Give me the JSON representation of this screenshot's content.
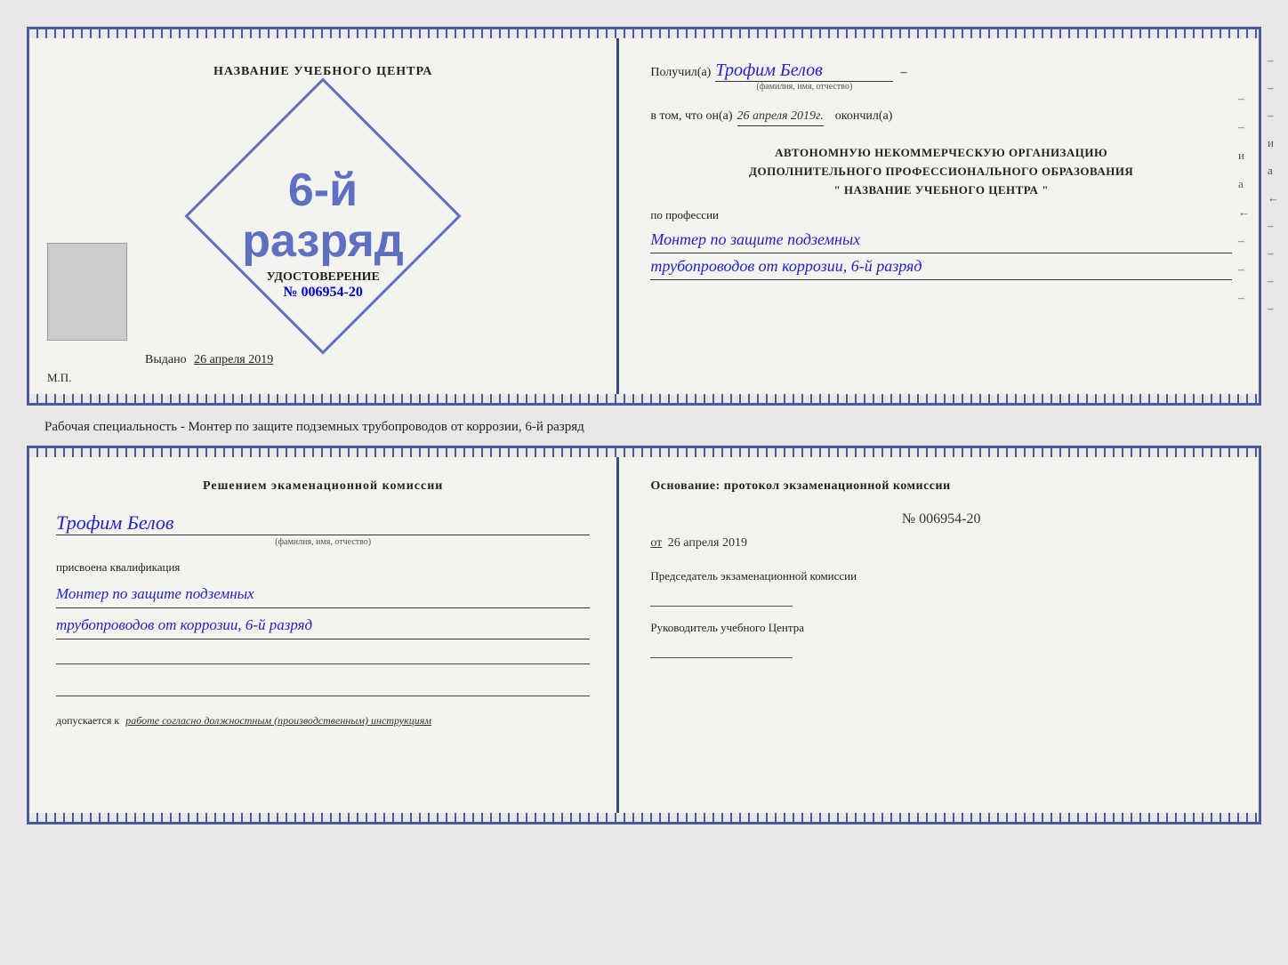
{
  "topDoc": {
    "leftSide": {
      "title": "НАЗВАНИЕ УЧЕБНОГО ЦЕНТРА",
      "certLabel": "УДОСТОВЕРЕНИЕ",
      "certNumber": "№ 006954-20",
      "stampLine1": "6-й",
      "stampLine2": "разряд",
      "issuedLabel": "Выдано",
      "issuedDate": "26 апреля 2019",
      "mpLabel": "М.П."
    },
    "rightSide": {
      "recipientLabel": "Получил(а)",
      "recipientName": "Трофим Белов",
      "recipientSubLabel": "(фамилия, имя, отчество)",
      "dashLabel": "–",
      "datePrefix": "в том, что он(а)",
      "dateValue": "26 апреля 2019г.",
      "dateAfter": "окончил(а)",
      "orgLine1": "АВТОНОМНУЮ НЕКОММЕРЧЕСКУЮ ОРГАНИЗАЦИЮ",
      "orgLine2": "ДОПОЛНИТЕЛЬНОГО ПРОФЕССИОНАЛЬНОГО ОБРАЗОВАНИЯ",
      "orgLine3": "\"   НАЗВАНИЕ УЧЕБНОГО ЦЕНТРА   \"",
      "profLabel": "по профессии",
      "profLine1": "Монтер по защите подземных",
      "profLine2": "трубопроводов от коррозии, 6-й разряд",
      "sideMarks": [
        "–",
        "–",
        "и",
        "а",
        "←",
        "–",
        "–",
        "–"
      ]
    }
  },
  "middleText": {
    "content": "Рабочая специальность - Монтер по защите подземных трубопроводов от коррозии, 6-й разряд"
  },
  "bottomDoc": {
    "leftSide": {
      "commissionTitle": "Решением экаменационной комиссии",
      "personName": "Трофим Белов",
      "personSubLabel": "(фамилия, имя, отчество)",
      "qualLabel": "присвоена квалификация",
      "qualLine1": "Монтер по защите подземных",
      "qualLine2": "трубопроводов от коррозии, 6-й разряд",
      "allowedLabel": "допускается к",
      "allowedValue": "работе согласно должностным (производственным) инструкциям"
    },
    "rightSide": {
      "basisTitle": "Основание: протокол экзаменационной комиссии",
      "protocolNumber": "№  006954-20",
      "datePrefix": "от",
      "dateValue": "26 апреля 2019",
      "chairLabel": "Председатель экзаменационной комиссии",
      "headLabel": "Руководитель учебного Центра",
      "sideMarks": [
        "–",
        "–",
        "–",
        "и",
        "а",
        "←",
        "–",
        "–",
        "–",
        "–"
      ]
    }
  }
}
